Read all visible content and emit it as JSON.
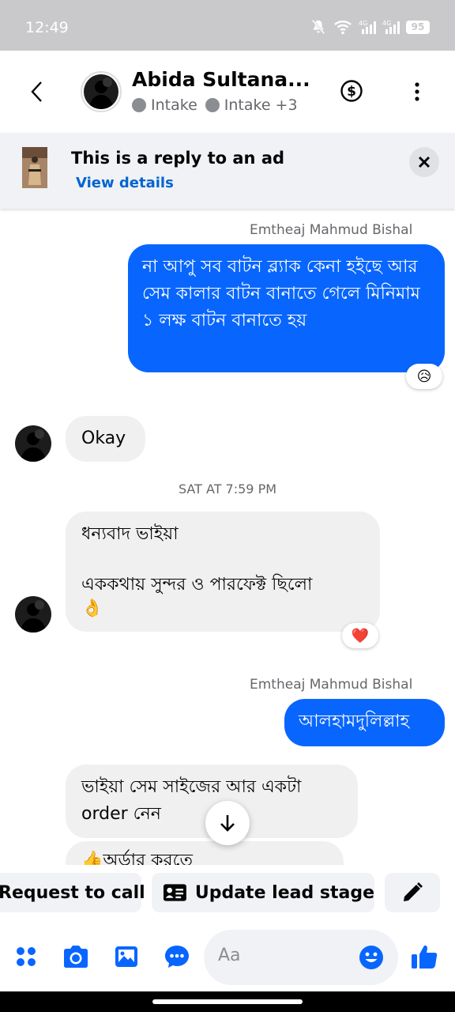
{
  "status_bar": {
    "time": "12:49",
    "battery": "95"
  },
  "header": {
    "contact_name": "Abida Sultana...",
    "label_1": "Intake",
    "label_2": "Intake",
    "more_labels": "+3"
  },
  "ad_banner": {
    "title": "This is a reply to an ad",
    "link": "View details"
  },
  "messages": [
    {
      "type": "outgoing",
      "sender": "Emtheaj Mahmud Bishal",
      "text": "না আপু সব বাটন ব্ল্যাক কেনা হইছে আর সেম কালার বাটন বানাতে গেলে মিনিমাম ১ লক্ষ বাটন বানাতে হয়",
      "reaction": "😥"
    },
    {
      "type": "incoming",
      "text": "Okay"
    },
    {
      "type": "timestamp",
      "text": "SAT AT 7:59 PM"
    },
    {
      "type": "incoming",
      "text_line1": "ধন্যবাদ ভাইয়া",
      "text_line2": "এককথায় সুন্দর ও পারফেক্ট ছিলো",
      "emoji": "👌",
      "reaction": "❤️"
    },
    {
      "type": "outgoing",
      "sender": "Emtheaj Mahmud Bishal",
      "text": "আলহামদুলিল্লাহ"
    },
    {
      "type": "incoming",
      "text_line1": "ভাইয়া সেম সাইজের আর একটা",
      "text_line2": "order নেন"
    },
    {
      "type": "incoming",
      "text": "👍অর্ডার করতে"
    }
  ],
  "actions": {
    "request_call": "Request to call",
    "update_lead": "Update lead stage"
  },
  "composer": {
    "placeholder": "Aa"
  },
  "colors": {
    "accent": "#0866ff",
    "bubble_in": "#f0f0f0"
  },
  "icons": [
    "back-arrow-icon",
    "dollar-icon",
    "more-vert-icon",
    "close-icon",
    "arrow-down-icon",
    "contact-card-icon",
    "pencil-icon",
    "apps-icon",
    "camera-icon",
    "gallery-icon",
    "chat-bubble-icon",
    "smiley-icon",
    "thumbs-up-icon"
  ]
}
